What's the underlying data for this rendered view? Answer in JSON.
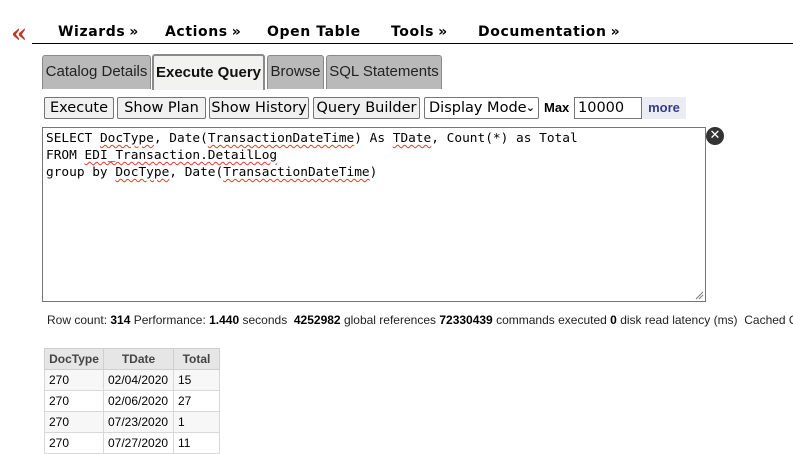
{
  "menu": {
    "items": [
      {
        "label": "Wizards",
        "arrow": "»"
      },
      {
        "label": "Actions",
        "arrow": "»"
      },
      {
        "label": "Open Table",
        "arrow": ""
      },
      {
        "label": "Tools",
        "arrow": "»"
      },
      {
        "label": "Documentation",
        "arrow": "»"
      }
    ],
    "back_glyph": "«"
  },
  "tabs": [
    {
      "label": "Catalog Details",
      "active": false
    },
    {
      "label": "Execute Query",
      "active": true
    },
    {
      "label": "Browse",
      "active": false
    },
    {
      "label": "SQL Statements",
      "active": false
    }
  ],
  "toolbar": {
    "execute": "Execute",
    "show_plan": "Show Plan",
    "show_history": "Show History",
    "query_builder": "Query Builder",
    "display_mode": "Display Mode",
    "max_label": "Max",
    "max_value": "10000",
    "more": "more"
  },
  "query": {
    "lines": [
      "SELECT DocType, Date(TransactionDateTime) As TDate, Count(*) as Total",
      "FROM EDI_Transaction.DetailLog",
      "group by DocType, Date(TransactionDateTime)"
    ]
  },
  "stats": {
    "row_count_label": "Row count:",
    "row_count": "314",
    "performance_label": "Performance:",
    "seconds": "1.440",
    "seconds_label": "seconds",
    "global_refs": "4252982",
    "global_refs_label": "global references",
    "commands": "72330439",
    "commands_label": "commands executed",
    "disk_latency": "0",
    "disk_latency_label": "disk read latency (ms)",
    "cached_label": "Cached Qu"
  },
  "results": {
    "columns": [
      "DocType",
      "TDate",
      "Total"
    ],
    "rows": [
      [
        "270",
        "02/04/2020",
        "15"
      ],
      [
        "270",
        "02/06/2020",
        "27"
      ],
      [
        "270",
        "07/23/2020",
        "1"
      ],
      [
        "270",
        "07/27/2020",
        "11"
      ]
    ]
  },
  "colors": {
    "back_icon": "#c0392b",
    "tab_active_bg": "#f2f2f0",
    "tab_bg": "#b9b9b9",
    "more_link": "#333a8a"
  }
}
